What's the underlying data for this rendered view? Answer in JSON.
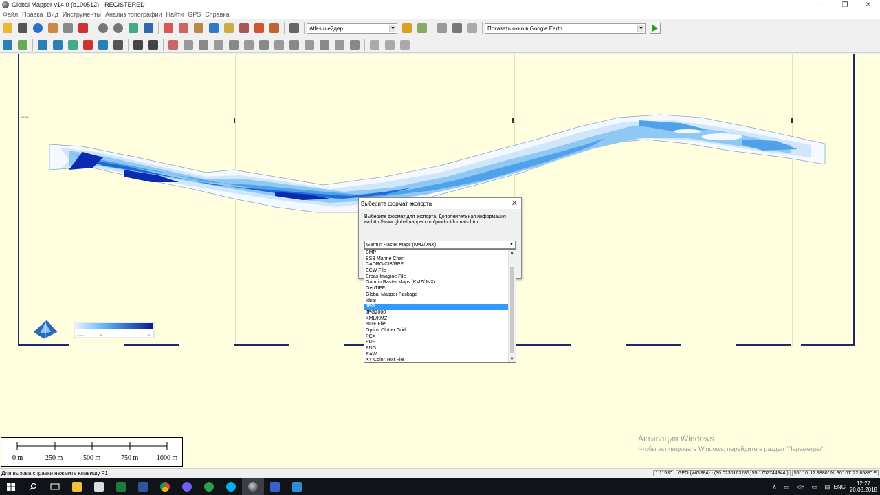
{
  "window": {
    "title": "Global Mapper v14.0 (b100512) - REGISTERED",
    "controls": {
      "minimize": "—",
      "maximize": "❐",
      "close": "✕"
    }
  },
  "menu": [
    "Файл",
    "Правка",
    "Вид",
    "Инструменты",
    "Анализ топографии",
    "Найти",
    "GPS",
    "Справка"
  ],
  "toolbar": {
    "shader_select": "Atlas шейдер",
    "google_earth_select": "Показать окно в Google Earth"
  },
  "map": {
    "top_left_label": "▪▪▪▪ ▪▪▪▪▪",
    "legend_left_text": "▪▪▪▪ ▪▪▪▪▪",
    "legend_mid_text": "▪▪▪",
    "legend_right_text": "▪▪▪"
  },
  "dialog": {
    "title": "Выберите формат экспорта",
    "close": "✕",
    "message_line1": "Выберите формат для экспорта. Дополнительная информация",
    "message_line2": "на http://www.globalmapper.com/product/formats.htm.",
    "selected_format": "Garmin Raster Maps (KMZ/JNX)",
    "options": [
      "BMP",
      "BSB Marine Chart",
      "CADRG/CIB/RPF",
      "ECW File",
      "Erdas Imagine File",
      "Garmin Raster Maps (KMZ/JNX)",
      "GeoTIFF",
      "Global Mapper Package",
      "Idrisi",
      "JPG",
      "JPG2000",
      "KML/KMZ",
      "NITF File",
      "Optimi Clutter Grid",
      "PCX",
      "PDF",
      "PNG",
      "RAW",
      "XY Color Text File"
    ],
    "highlighted_index": 9
  },
  "scalebar": {
    "labels": [
      "0 m",
      "250 m",
      "500 m",
      "750 m",
      "1000 m"
    ]
  },
  "activation": {
    "title": "Активация Windows",
    "subtitle": "Чтобы активировать Windows, перейдите в раздел \"Параметры\"."
  },
  "status": {
    "help": "Для вызова справки нажмите клавишу F1",
    "scale": "1:11530",
    "projection": "GEO (WGS84) - (30.0230163285, 55.1702744344 )",
    "coords": "55° 10' 12.9880\" N, 30° 01' 22.8588\" E"
  },
  "taskbar": {
    "lang": "ENG",
    "time": "12:27",
    "date": "20.08.2018"
  },
  "colors": {
    "map_bg": "#ffffe0",
    "accent": "#3399ff"
  }
}
